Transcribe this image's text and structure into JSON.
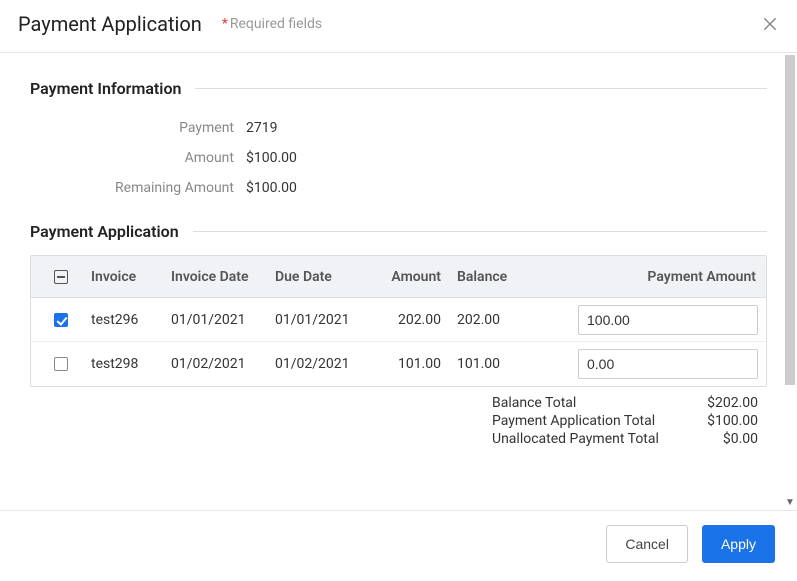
{
  "header": {
    "title": "Payment Application",
    "required_label": "Required fields",
    "required_star": "*"
  },
  "sections": {
    "payment_info": {
      "title": "Payment Information",
      "rows": [
        {
          "label": "Payment",
          "value": "2719"
        },
        {
          "label": "Amount",
          "value": "$100.00"
        },
        {
          "label": "Remaining Amount",
          "value": "$100.00"
        }
      ]
    },
    "payment_app": {
      "title": "Payment Application",
      "columns": {
        "invoice": "Invoice",
        "invoice_date": "Invoice Date",
        "due_date": "Due Date",
        "amount": "Amount",
        "balance": "Balance",
        "payment_amount": "Payment Amount"
      },
      "rows": [
        {
          "checked": true,
          "invoice": "test296",
          "invoice_date": "01/01/2021",
          "due_date": "01/01/2021",
          "amount": "202.00",
          "balance": "202.00",
          "payment_amount": "100.00"
        },
        {
          "checked": false,
          "invoice": "test298",
          "invoice_date": "01/02/2021",
          "due_date": "01/02/2021",
          "amount": "101.00",
          "balance": "101.00",
          "payment_amount": "0.00"
        }
      ],
      "totals": [
        {
          "label": "Balance Total",
          "value": "$202.00"
        },
        {
          "label": "Payment Application Total",
          "value": "$100.00"
        },
        {
          "label": "Unallocated Payment Total",
          "value": "$0.00"
        }
      ]
    }
  },
  "footer": {
    "cancel": "Cancel",
    "apply": "Apply"
  }
}
